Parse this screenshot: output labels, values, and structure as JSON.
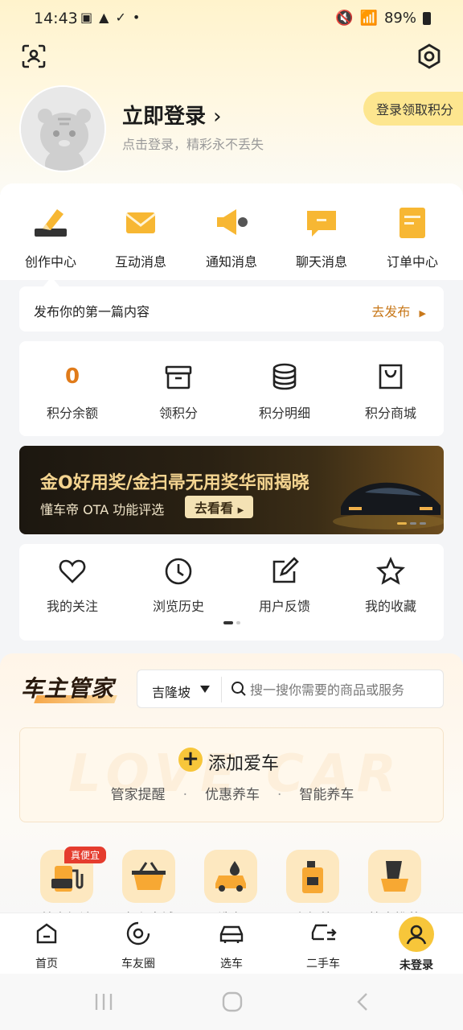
{
  "status_bar": {
    "time": "14:43",
    "battery": "89%"
  },
  "profile": {
    "login_title": "立即登录",
    "login_subtitle": "点击登录，精彩永不丢失",
    "points_button": "登录领取积分"
  },
  "messages": [
    {
      "label": "创作中心",
      "icon": "pencil-icon"
    },
    {
      "label": "互动消息",
      "icon": "envelope-icon"
    },
    {
      "label": "通知消息",
      "icon": "megaphone-icon"
    },
    {
      "label": "聊天消息",
      "icon": "chat-icon"
    },
    {
      "label": "订单中心",
      "icon": "order-icon"
    }
  ],
  "publish": {
    "text": "发布你的第一篇内容",
    "action": "去发布"
  },
  "points": [
    {
      "value": "0",
      "label": "积分余额"
    },
    {
      "label": "领积分",
      "icon": "gift-box-icon"
    },
    {
      "label": "积分明细",
      "icon": "coins-icon"
    },
    {
      "label": "积分商城",
      "icon": "shopping-bag-icon"
    }
  ],
  "banner": {
    "title": "金O好用奖/金扫帚无用奖华丽揭晓",
    "subtitle": "懂车帝 OTA 功能评选",
    "button": "去看看"
  },
  "tools": [
    {
      "label": "我的关注",
      "icon": "heart-icon"
    },
    {
      "label": "浏览历史",
      "icon": "clock-icon"
    },
    {
      "label": "用户反馈",
      "icon": "edit-icon"
    },
    {
      "label": "我的收藏",
      "icon": "star-icon"
    }
  ],
  "butler": {
    "logo": "车主管家",
    "city": "吉隆坡",
    "search_placeholder": "搜一搜你需要的商品或服务",
    "add_car": "添加爱车",
    "features": [
      "管家提醒",
      "优惠养车",
      "智能养车"
    ],
    "watermark": "LOVE CAR"
  },
  "services": [
    {
      "label": "特惠加油",
      "icon": "fuel-pump-icon",
      "badge": "真便宜"
    },
    {
      "label": "车主商城",
      "icon": "basket-icon"
    },
    {
      "label": "洗车",
      "icon": "car-wash-icon"
    },
    {
      "label": "小保养",
      "icon": "oil-can-icon"
    },
    {
      "label": "笔直推荐",
      "icon": "seat-cover-icon"
    }
  ],
  "nav": [
    {
      "label": "首页",
      "icon": "home-icon"
    },
    {
      "label": "车友圈",
      "icon": "circle-icon"
    },
    {
      "label": "选车",
      "icon": "car-icon"
    },
    {
      "label": "二手车",
      "icon": "used-car-icon"
    },
    {
      "label": "未登录",
      "icon": "user-icon",
      "active": true
    }
  ]
}
